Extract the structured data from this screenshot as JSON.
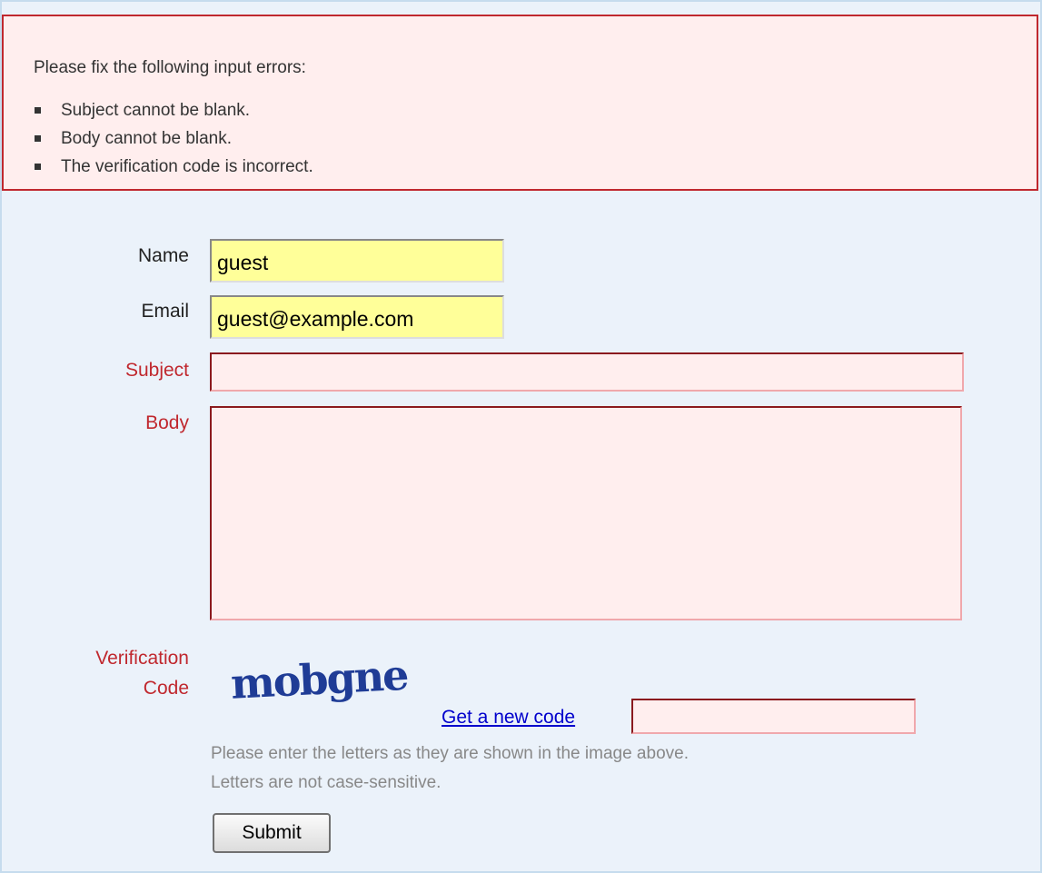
{
  "error_summary": {
    "heading": "Please fix the following input errors:",
    "errors": [
      "Subject cannot be blank.",
      "Body cannot be blank.",
      "The verification code is incorrect."
    ]
  },
  "form": {
    "name": {
      "label": "Name",
      "value": "guest"
    },
    "email": {
      "label": "Email",
      "value": "guest@example.com"
    },
    "subject": {
      "label": "Subject",
      "value": ""
    },
    "body": {
      "label": "Body",
      "value": ""
    },
    "verification": {
      "label_line1": "Verification",
      "label_line2": "Code",
      "captcha_text": "mobgne",
      "new_code_link": "Get a new code",
      "value": "",
      "hint_line1": "Please enter the letters as they are shown in the image above.",
      "hint_line2": "Letters are not case-sensitive."
    },
    "submit_label": "Submit"
  },
  "colors": {
    "panel_background": "#ebf2fa",
    "error_background": "#ffeeee",
    "error_border": "#c0282e",
    "error_label": "#c0282e",
    "valid_input_background": "#ffff99",
    "link": "#0000cc",
    "captcha": "#1f3c96"
  }
}
